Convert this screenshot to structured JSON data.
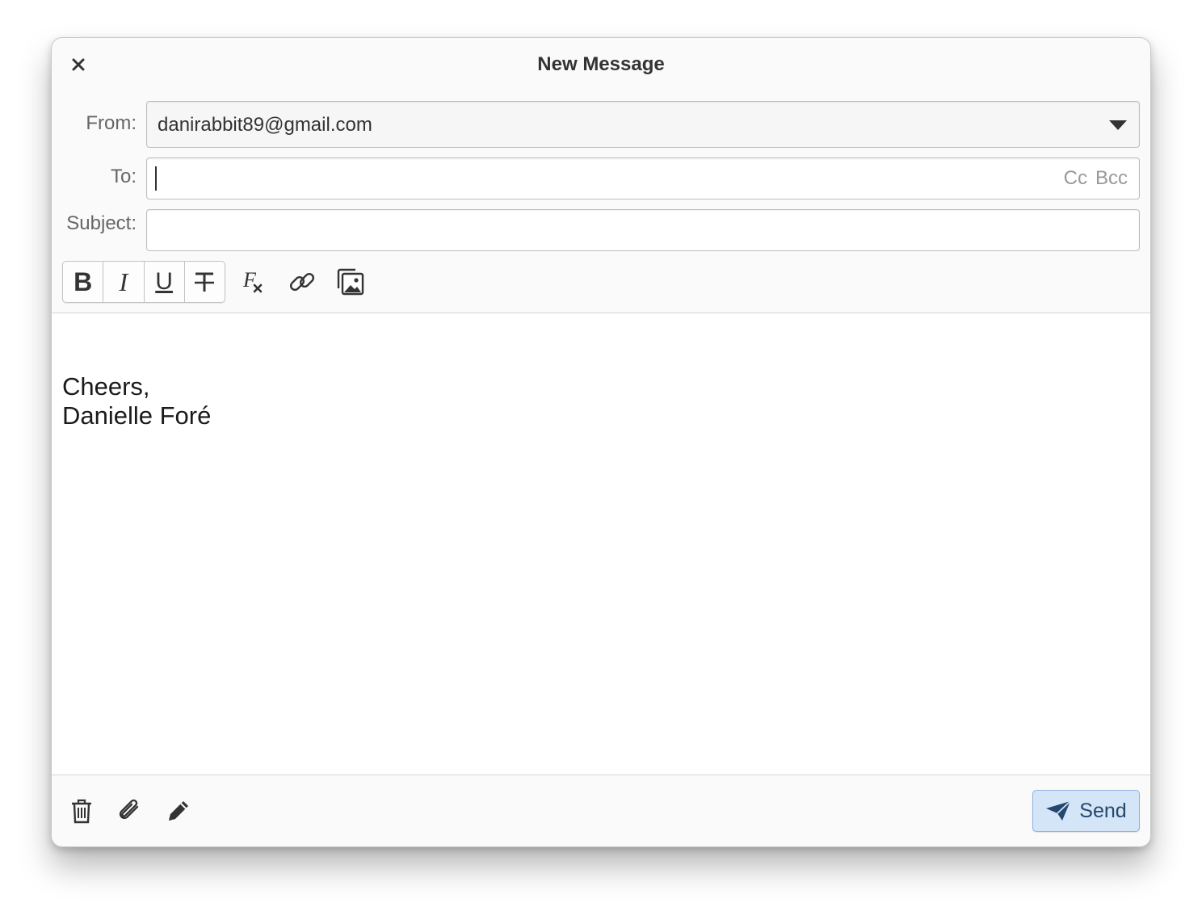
{
  "window": {
    "title": "New Message"
  },
  "fields": {
    "from_label": "From:",
    "from_value": "danirabbit89@gmail.com",
    "to_label": "To:",
    "to_value": "",
    "cc_label": "Cc",
    "bcc_label": "Bcc",
    "subject_label": "Subject:",
    "subject_value": ""
  },
  "toolbar": {
    "bold_label": "B",
    "italic_label": "I",
    "underline_label": "U",
    "strikethrough_icon": "strikethrough-icon",
    "clear_format_icon": "clear-formatting-icon",
    "link_icon": "link-icon",
    "image_icon": "insert-image-icon"
  },
  "body": {
    "line1": "Cheers,",
    "line2": "Danielle Foré"
  },
  "footer": {
    "delete_icon": "trash-icon",
    "attach_icon": "paperclip-icon",
    "edit_icon": "pencil-icon",
    "send_label": "Send"
  },
  "colors": {
    "accent_bg": "#d4e5f8",
    "accent_border": "#8db3de",
    "accent_text": "#24476d"
  }
}
